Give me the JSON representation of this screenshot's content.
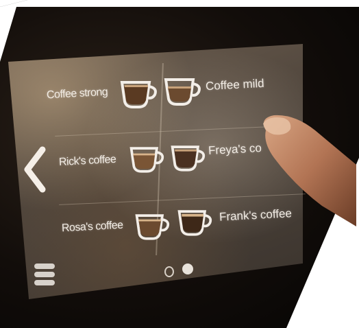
{
  "screen": {
    "rows": [
      {
        "left_label": "Coffee strong",
        "right_label": "Coffee mild"
      },
      {
        "left_label": "Rick's coffee",
        "right_label": "Freya's co"
      },
      {
        "left_label": "Rosa's coffee",
        "right_label": "Frank's coffee"
      }
    ],
    "page_indicator": {
      "pages": 2,
      "current": 2
    }
  },
  "colors": {
    "screen_tint": "#5a4e43",
    "text": "#f2ece4",
    "crema": "#c8a27a",
    "coffee": "#6b4a2f"
  },
  "icons": [
    "back-arrow-icon",
    "coffee-cup-icon",
    "menu-icon"
  ]
}
